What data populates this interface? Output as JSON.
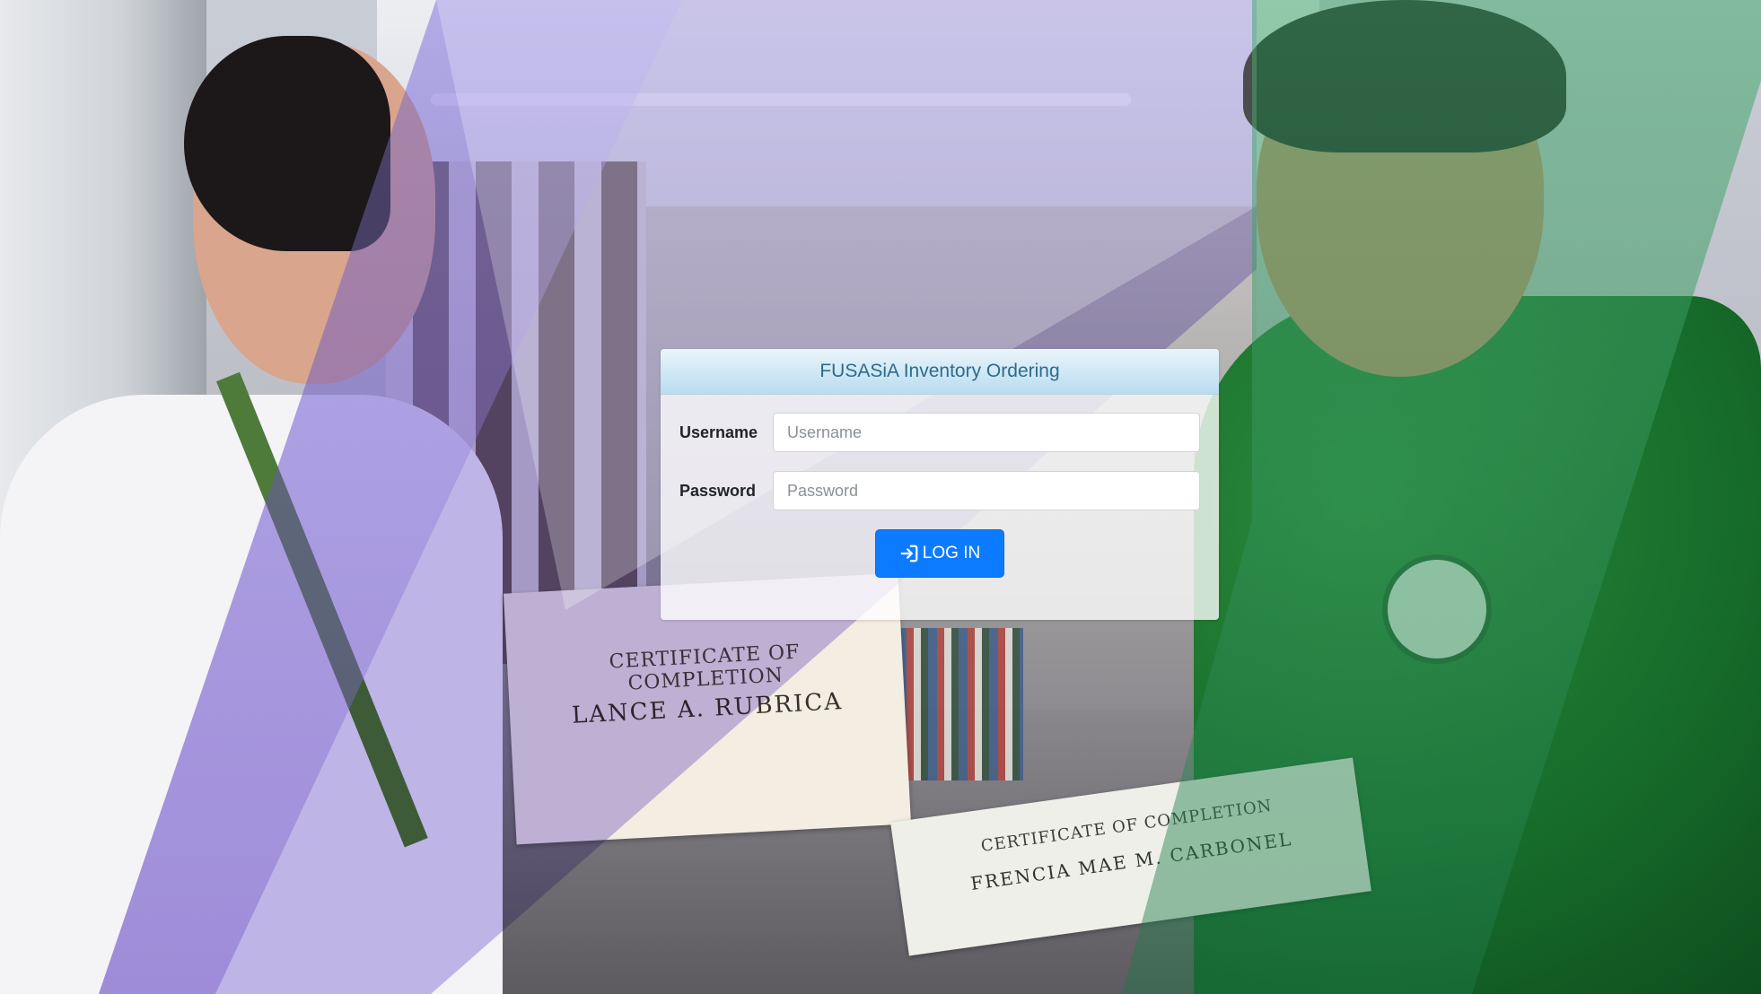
{
  "background": {
    "certificate_left": {
      "title": "CERTIFICATE OF COMPLETION",
      "name": "LANCE A. RUBRICA"
    },
    "certificate_right": {
      "title": "CERTIFICATE OF COMPLETION",
      "name": "FRENCIA MAE M. CARBONEL"
    }
  },
  "login": {
    "title": "FUSASiA Inventory Ordering",
    "username_label": "Username",
    "username_placeholder": "Username",
    "username_value": "",
    "password_label": "Password",
    "password_placeholder": "Password",
    "password_value": "",
    "submit_label": "LOG IN",
    "submit_icon": "sign-in-icon"
  },
  "colors": {
    "header_text": "#2d6b8e",
    "button": "#0d7bff",
    "purple_overlay": "#826edc",
    "green_overlay": "#46aa6e"
  }
}
